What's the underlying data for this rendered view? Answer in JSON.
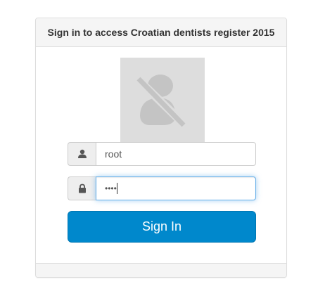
{
  "panel": {
    "title": "Sign in to access Croatian dentists register 2015"
  },
  "avatar": {
    "icon": "user-slash-icon"
  },
  "login": {
    "username_icon": "user-icon",
    "username_value": "root",
    "password_icon": "lock-icon",
    "password_value": "••••",
    "submit_label": "Sign In"
  },
  "colors": {
    "primary": "#0088cc",
    "focus_border": "#66afe9",
    "avatar_bg": "#dddddd",
    "avatar_fg": "#c4c4c4"
  }
}
